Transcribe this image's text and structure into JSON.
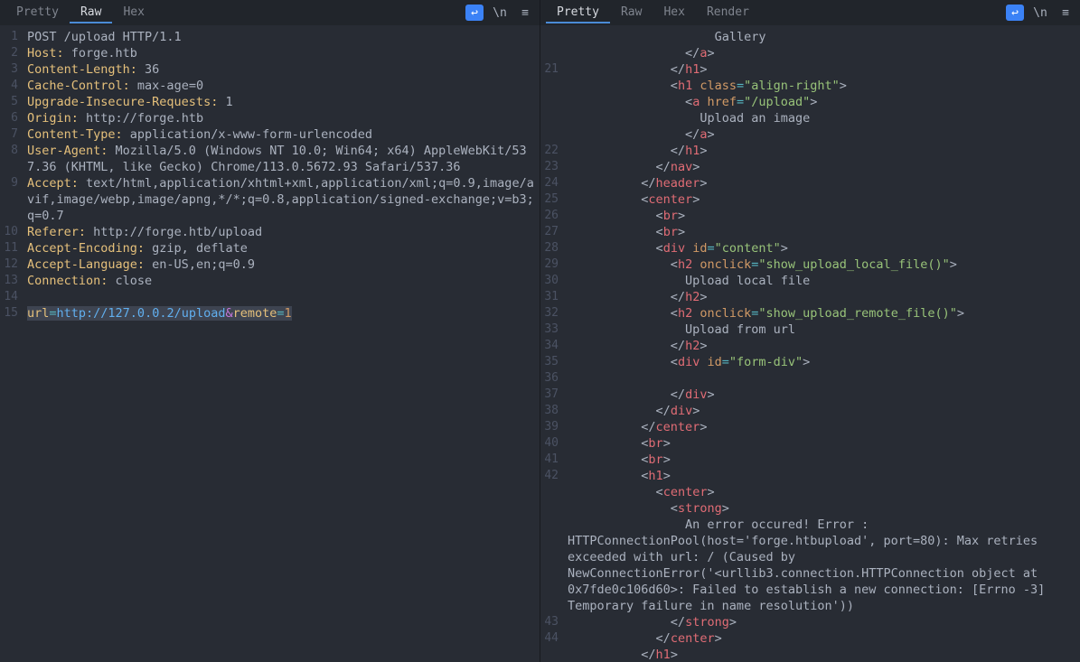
{
  "left": {
    "tabs": [
      "Pretty",
      "Raw",
      "Hex"
    ],
    "active_tab": "Raw",
    "icons": {
      "wrap": "↩",
      "newline": "\\n",
      "menu": "≡"
    },
    "gutter": [
      "1",
      "2",
      "3",
      "4",
      "5",
      "6",
      "7",
      "8",
      "9",
      "10",
      "11",
      "12",
      "13",
      "14",
      "15"
    ],
    "request_line": "POST /upload HTTP/1.1",
    "headers": [
      {
        "k": "Host:",
        "v": " forge.htb"
      },
      {
        "k": "Content-Length:",
        "v": " 36"
      },
      {
        "k": "Cache-Control:",
        "v": " max-age=0"
      },
      {
        "k": "Upgrade-Insecure-Requests:",
        "v": " 1"
      },
      {
        "k": "Origin:",
        "v": " http://forge.htb"
      },
      {
        "k": "Content-Type:",
        "v": " application/x-www-form-urlencoded"
      },
      {
        "k": "User-Agent:",
        "v": " Mozilla/5.0 (Windows NT 10.0; Win64; x64) AppleWebKit/537.36 (KHTML, like Gecko) Chrome/113.0.5672.93 Safari/537.36"
      },
      {
        "k": "Accept:",
        "v": " text/html,application/xhtml+xml,application/xml;q=0.9,image/avif,image/webp,image/apng,*/*;q=0.8,application/signed-exchange;v=b3;q=0.7"
      },
      {
        "k": "Referer:",
        "v": " http://forge.htb/upload"
      },
      {
        "k": "Accept-Encoding:",
        "v": " gzip, deflate"
      },
      {
        "k": "Accept-Language:",
        "v": " en-US,en;q=0.9"
      },
      {
        "k": "Connection:",
        "v": " close"
      }
    ],
    "body": {
      "p1": "url",
      "eq1": "=",
      "url": "http://127.0.0.2/upload",
      "amp": "&",
      "p2": "remote",
      "eq2": "=",
      "val": "1"
    }
  },
  "right": {
    "tabs": [
      "Pretty",
      "Raw",
      "Hex",
      "Render"
    ],
    "active_tab": "Pretty",
    "icons": {
      "wrap": "↩",
      "newline": "\\n",
      "menu": "≡"
    },
    "gutter": [
      "",
      "",
      "21",
      "",
      "",
      "",
      "",
      "22",
      "23",
      "24",
      "25",
      "26",
      "27",
      "28",
      "29",
      "30",
      "31",
      "32",
      "33",
      "34",
      "35",
      "36",
      "37",
      "38",
      "39",
      "40",
      "41",
      "42",
      "",
      "",
      "",
      "",
      "",
      "",
      "",
      "43",
      "44"
    ],
    "code": [
      {
        "indent": 10,
        "t": "text",
        "v": "Gallery"
      },
      {
        "indent": 8,
        "t": "close-a"
      },
      {
        "indent": 7,
        "t": "close",
        "tag": "h1"
      },
      {
        "indent": 7,
        "t": "open-attr",
        "tag": "h1",
        "attr": "class",
        "val": "\"align-right\""
      },
      {
        "indent": 8,
        "t": "open-attr",
        "tag": "a",
        "attr": "href",
        "val": "\"/upload\""
      },
      {
        "indent": 9,
        "t": "text",
        "v": "Upload an image"
      },
      {
        "indent": 8,
        "t": "close-a"
      },
      {
        "indent": 7,
        "t": "close",
        "tag": "h1"
      },
      {
        "indent": 6,
        "t": "close",
        "tag": "nav"
      },
      {
        "indent": 5,
        "t": "close",
        "tag": "header"
      },
      {
        "indent": 5,
        "t": "open",
        "tag": "center"
      },
      {
        "indent": 6,
        "t": "self",
        "tag": "br"
      },
      {
        "indent": 6,
        "t": "self",
        "tag": "br"
      },
      {
        "indent": 6,
        "t": "open-attr",
        "tag": "div",
        "attr": "id",
        "val": "\"content\""
      },
      {
        "indent": 7,
        "t": "open-attr",
        "tag": "h2",
        "attr": "onclick",
        "val": "\"show_upload_local_file()\""
      },
      {
        "indent": 8,
        "t": "text",
        "v": "Upload local file"
      },
      {
        "indent": 7,
        "t": "close",
        "tag": "h2"
      },
      {
        "indent": 7,
        "t": "open-attr",
        "tag": "h2",
        "attr": "onclick",
        "val": "\"show_upload_remote_file()\""
      },
      {
        "indent": 8,
        "t": "text",
        "v": "Upload from url"
      },
      {
        "indent": 7,
        "t": "close",
        "tag": "h2"
      },
      {
        "indent": 7,
        "t": "open-attr",
        "tag": "div",
        "attr": "id",
        "val": "\"form-div\""
      },
      {
        "indent": 0,
        "t": "blank"
      },
      {
        "indent": 7,
        "t": "close",
        "tag": "div"
      },
      {
        "indent": 6,
        "t": "close",
        "tag": "div"
      },
      {
        "indent": 5,
        "t": "close",
        "tag": "center"
      },
      {
        "indent": 5,
        "t": "self",
        "tag": "br"
      },
      {
        "indent": 5,
        "t": "self",
        "tag": "br"
      },
      {
        "indent": 5,
        "t": "open",
        "tag": "h1"
      },
      {
        "indent": 6,
        "t": "open",
        "tag": "center"
      },
      {
        "indent": 7,
        "t": "open",
        "tag": "strong"
      },
      {
        "indent": 8,
        "t": "text",
        "v": "An error occured! Error : HTTPConnectionPool(host=&#39;forge.htbupload&#39;, port=80): Max retries exceeded with url: / (Caused by NewConnectionError(&#39;&lt;urllib3.connection.HTTPConnection object at 0x7fde0c106d60&gt;: Failed to establish a new connection: [Errno -3] Temporary failure in name resolution&#39;))"
      },
      {
        "indent": 7,
        "t": "close",
        "tag": "strong"
      },
      {
        "indent": 6,
        "t": "close",
        "tag": "center"
      },
      {
        "indent": 5,
        "t": "close",
        "tag": "h1"
      }
    ]
  }
}
